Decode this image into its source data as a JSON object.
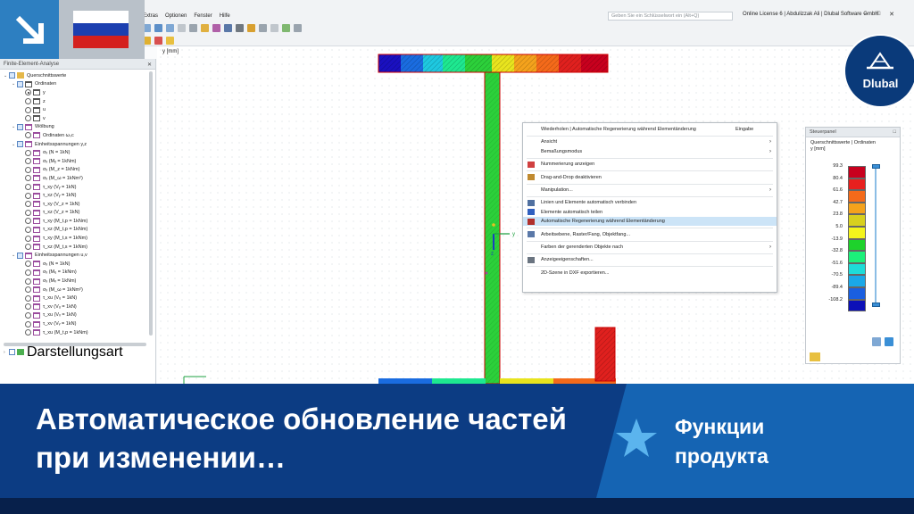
{
  "menu": {
    "items": [
      "Extras",
      "Optionen",
      "Fenster",
      "Hilfe"
    ]
  },
  "search": {
    "placeholder": "Geben Sie ein Schlüsselwort ein (Alt+Q)"
  },
  "license": "Online License 6 | Abdulizzak Ali | Dlubal Software GmbH",
  "panel": {
    "title": "Finite-Element-Analyse",
    "tree": [
      {
        "indent": 0,
        "chev": "⌄",
        "cb": true,
        "icon": "fold",
        "label": "Querschnittswerte"
      },
      {
        "indent": 1,
        "chev": "⌄",
        "cb": true,
        "icon": "dark",
        "label": "Ordinaten"
      },
      {
        "indent": 2,
        "chev": "",
        "radio": "sel",
        "icon": "dark",
        "label": "y"
      },
      {
        "indent": 2,
        "chev": "",
        "radio": "",
        "icon": "dark",
        "label": "z"
      },
      {
        "indent": 2,
        "chev": "",
        "radio": "",
        "icon": "dark",
        "label": "u"
      },
      {
        "indent": 2,
        "chev": "",
        "radio": "",
        "icon": "dark",
        "label": "v"
      },
      {
        "indent": 1,
        "chev": "⌄",
        "cb": true,
        "icon": "p",
        "label": "Wölbung"
      },
      {
        "indent": 2,
        "chev": "",
        "radio": "",
        "icon": "p",
        "label": "Ordinaten ωₛc"
      },
      {
        "indent": 1,
        "chev": "⌄",
        "cb": true,
        "icon": "p",
        "label": "Einheitsspannungen y,z"
      },
      {
        "indent": 2,
        "chev": "",
        "radio": "",
        "icon": "p",
        "label": "σₓ (N = 1kN)"
      },
      {
        "indent": 2,
        "chev": "",
        "radio": "",
        "icon": "p",
        "label": "σₓ (Mᵧ = 1kNm)"
      },
      {
        "indent": 2,
        "chev": "",
        "radio": "",
        "icon": "p",
        "label": "σₓ (M_z = 1kNm)"
      },
      {
        "indent": 2,
        "chev": "",
        "radio": "",
        "icon": "p",
        "label": "σₓ (M_ω = 1kNm²)"
      },
      {
        "indent": 2,
        "chev": "",
        "radio": "",
        "icon": "p",
        "label": "τ_xy (Vᵧ = 1kN)"
      },
      {
        "indent": 2,
        "chev": "",
        "radio": "",
        "icon": "p",
        "label": "τ_xz (Vᵧ = 1kN)"
      },
      {
        "indent": 2,
        "chev": "",
        "radio": "",
        "icon": "p",
        "label": "τ_xy (V_z = 1kN)"
      },
      {
        "indent": 2,
        "chev": "",
        "radio": "",
        "icon": "p",
        "label": "τ_xz (V_z = 1kN)"
      },
      {
        "indent": 2,
        "chev": "",
        "radio": "",
        "icon": "p",
        "label": "τ_xy (M_t,p = 1kNm)"
      },
      {
        "indent": 2,
        "chev": "",
        "radio": "",
        "icon": "p",
        "label": "τ_xz (M_t,p = 1kNm)"
      },
      {
        "indent": 2,
        "chev": "",
        "radio": "",
        "icon": "p",
        "label": "τ_xy (M_t,s = 1kNm)"
      },
      {
        "indent": 2,
        "chev": "",
        "radio": "",
        "icon": "p",
        "label": "τ_xz (M_t,s = 1kNm)"
      },
      {
        "indent": 1,
        "chev": "⌄",
        "cb": true,
        "icon": "p",
        "label": "Einheitsspannungen u,v"
      },
      {
        "indent": 2,
        "chev": "",
        "radio": "",
        "icon": "p",
        "label": "σₓ (N = 1kN)"
      },
      {
        "indent": 2,
        "chev": "",
        "radio": "",
        "icon": "p",
        "label": "σₓ (Mᵤ = 1kNm)"
      },
      {
        "indent": 2,
        "chev": "",
        "radio": "",
        "icon": "p",
        "label": "σₓ (Mᵥ = 1kNm)"
      },
      {
        "indent": 2,
        "chev": "",
        "radio": "",
        "icon": "p",
        "label": "σₓ (M_ω = 1kNm²)"
      },
      {
        "indent": 2,
        "chev": "",
        "radio": "",
        "icon": "p",
        "label": "τ_xu (Vᵤ = 1kN)"
      },
      {
        "indent": 2,
        "chev": "",
        "radio": "",
        "icon": "p",
        "label": "τ_xv (Vᵤ = 1kN)"
      },
      {
        "indent": 2,
        "chev": "",
        "radio": "",
        "icon": "p",
        "label": "τ_xu (Vᵥ = 1kN)"
      },
      {
        "indent": 2,
        "chev": "",
        "radio": "",
        "icon": "p",
        "label": "τ_xv (Vᵥ = 1kN)"
      },
      {
        "indent": 2,
        "chev": "",
        "radio": "",
        "icon": "p",
        "label": "τ_xu (M_t,p = 1kNm)"
      }
    ],
    "footer_item": "Darstellungsart"
  },
  "canvas": {
    "axis_label": "y [mm]",
    "axis_y": "y",
    "axis_z": "z"
  },
  "context_menu": {
    "items": [
      {
        "label": "Wiederholen | Automatische Regenerierung während Elementänderung",
        "shortcut": "Eingabe",
        "arrow": false,
        "icon": "",
        "hl": false
      },
      {
        "sep": true
      },
      {
        "label": "Ansicht",
        "arrow": true,
        "icon": "",
        "hl": false
      },
      {
        "label": "Bemaßungsmodus",
        "arrow": true,
        "icon": "",
        "hl": false
      },
      {
        "sep": true
      },
      {
        "label": "Nummerierung anzeigen",
        "arrow": false,
        "icon": "num",
        "hl": false
      },
      {
        "sep": true
      },
      {
        "label": "Drag-and-Drop deaktivieren",
        "arrow": false,
        "icon": "drag",
        "hl": false
      },
      {
        "sep": true
      },
      {
        "label": "Manipulation...",
        "arrow": true,
        "icon": "",
        "hl": false
      },
      {
        "sep": true
      },
      {
        "label": "Linien und Elemente automatisch verbinden",
        "arrow": false,
        "icon": "x",
        "hl": false
      },
      {
        "label": "Elemente automatisch teilen",
        "arrow": false,
        "icon": "split",
        "hl": false
      },
      {
        "label": "Automatische Regenerierung während Elementänderung",
        "arrow": false,
        "icon": "regen",
        "hl": true
      },
      {
        "sep": true
      },
      {
        "label": "Arbeitsebene, Raster/Fang, Objektfang...",
        "arrow": false,
        "icon": "grid",
        "hl": false
      },
      {
        "sep": true
      },
      {
        "label": "Farben der gerenderten Objekte nach",
        "arrow": true,
        "icon": "",
        "hl": false
      },
      {
        "sep": true
      },
      {
        "label": "Anzeigeeigenschaften...",
        "arrow": false,
        "icon": "prop",
        "hl": false
      },
      {
        "sep": true
      },
      {
        "label": "2D-Szene in DXF exportieren...",
        "arrow": false,
        "icon": "",
        "hl": false
      }
    ]
  },
  "steuerpanel": {
    "title": "Steuerpanel",
    "line1": "Querschnittswerte | Ordinaten",
    "line2": "y [mm]",
    "legend": [
      {
        "value": "99.3",
        "color": "#c8001e"
      },
      {
        "value": "80.4",
        "color": "#e8201e"
      },
      {
        "value": "61.6",
        "color": "#f46a1a"
      },
      {
        "value": "42.7",
        "color": "#f4a21c"
      },
      {
        "value": "23.8",
        "color": "#d8d01e"
      },
      {
        "value": "5.0",
        "color": "#f4f41c"
      },
      {
        "value": "-13.9",
        "color": "#1ed22c"
      },
      {
        "value": "-32.8",
        "color": "#1cf07a"
      },
      {
        "value": "-51.6",
        "color": "#1edcd8"
      },
      {
        "value": "-70.5",
        "color": "#1aa8e8"
      },
      {
        "value": "-89.4",
        "color": "#1a5fe0"
      },
      {
        "value": "-108.2",
        "color": "#0c10b8"
      }
    ]
  },
  "logo": {
    "name": "Dlubal"
  },
  "banner": {
    "title": "Автоматическое обновление частей при изменении…",
    "subtitle": "Функции продукта"
  },
  "colors": {
    "banner_dark": "#0c3c83",
    "banner_light": "#1564b3",
    "accent": "#2d7fc1"
  }
}
